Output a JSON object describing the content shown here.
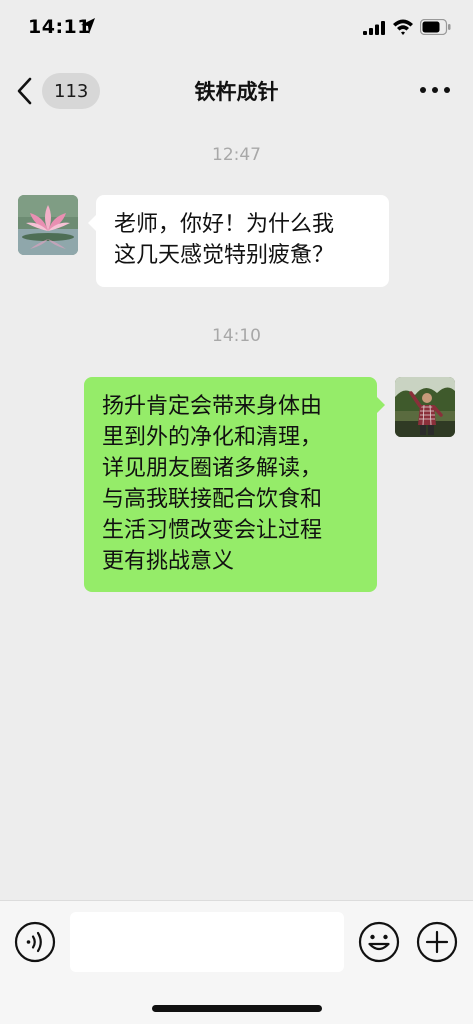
{
  "status_bar": {
    "time": "14:11"
  },
  "nav": {
    "unread_count": "113",
    "title": "铁杵成针"
  },
  "messages": [
    {
      "timestamp": "12:47",
      "side": "left",
      "lines": [
        "老师，你好！为什么我",
        "这几天感觉特别疲惫？"
      ]
    },
    {
      "timestamp": "14:10",
      "side": "right",
      "lines": [
        "扬升肯定会带来身体由",
        "里到外的净化和清理，",
        "详见朋友圈诸多解读，",
        "与高我联接配合饮食和",
        "生活习惯改变会让过程",
        "更有挑战意义"
      ]
    }
  ],
  "input_bar": {
    "text_value": ""
  },
  "colors": {
    "background": "#ededed",
    "bubble_left": "#ffffff",
    "bubble_right": "#95ec69",
    "timestamp": "#a8a8a8"
  },
  "icons": [
    "location-arrow-icon",
    "signal-icon",
    "wifi-icon",
    "battery-icon",
    "back-arrow-icon",
    "more-icon",
    "voice-icon",
    "emoji-icon",
    "plus-icon"
  ]
}
